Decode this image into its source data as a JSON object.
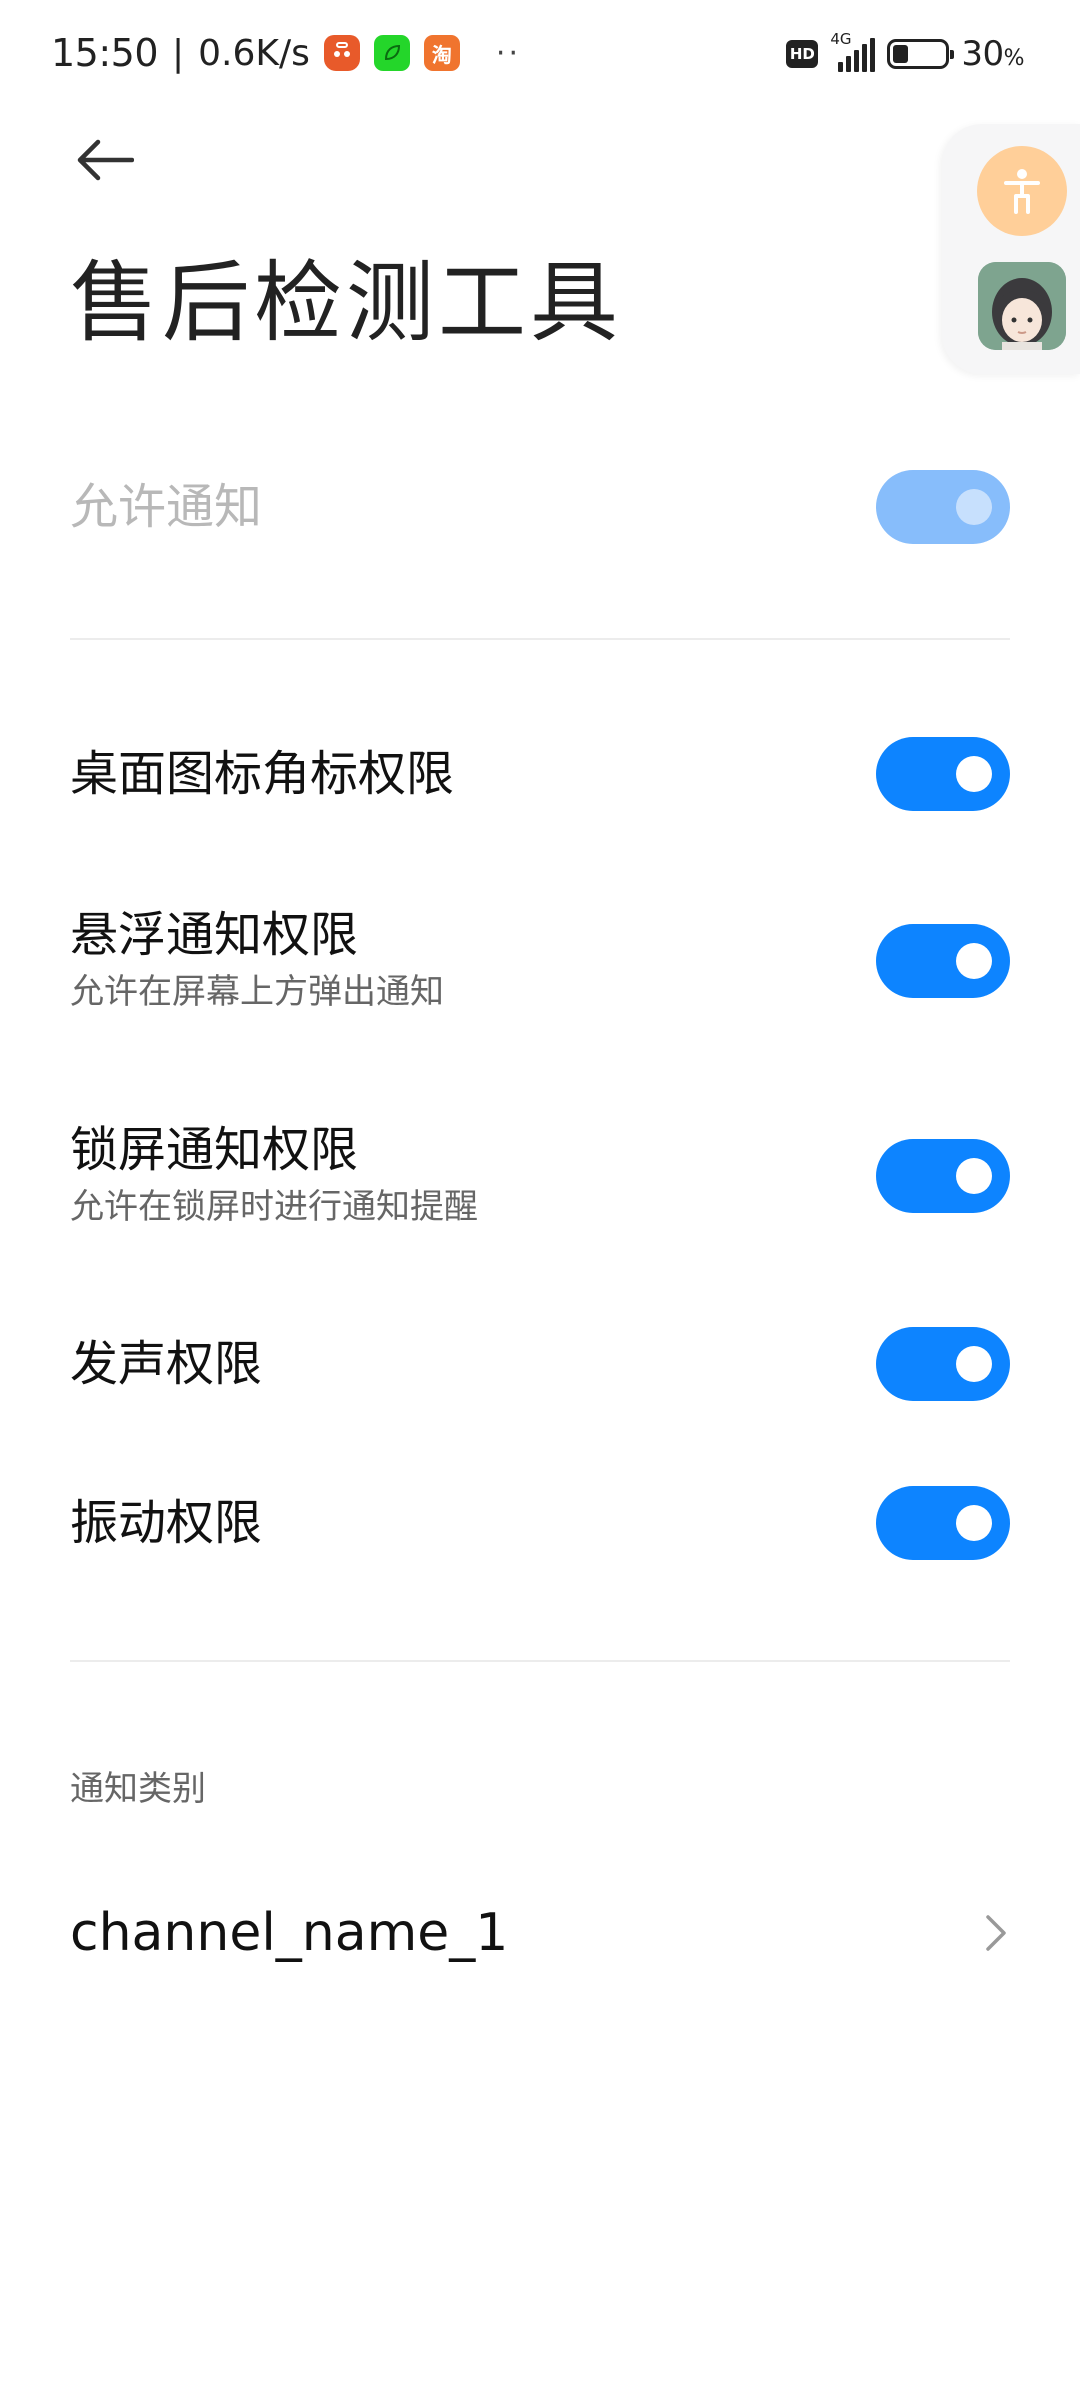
{
  "status_bar": {
    "time": "15:50",
    "separator": "|",
    "net_speed": "0.6K/s",
    "app_icons": [
      "shopping-bag-icon",
      "green-app-icon",
      "taobao-icon"
    ],
    "taobao_glyph": "淘",
    "more_dots": "··",
    "hd_label": "HD",
    "network_type": "4G",
    "battery_level": 0.3,
    "battery_text": "30",
    "battery_unit": "%"
  },
  "header": {
    "title": "售后检测工具"
  },
  "settings": {
    "allow_notifications": {
      "label": "允许通知",
      "enabled": true,
      "disabled": true
    },
    "items": [
      {
        "label": "桌面图标角标权限",
        "subtitle": "",
        "enabled": true
      },
      {
        "label": "悬浮通知权限",
        "subtitle": "允许在屏幕上方弹出通知",
        "enabled": true
      },
      {
        "label": "锁屏通知权限",
        "subtitle": "允许在锁屏时进行通知提醒",
        "enabled": true
      },
      {
        "label": "发声权限",
        "subtitle": "",
        "enabled": true
      },
      {
        "label": "振动权限",
        "subtitle": "",
        "enabled": true
      }
    ]
  },
  "categories": {
    "header": "通知类别",
    "channels": [
      {
        "label": "channel_name_1"
      }
    ]
  },
  "colors": {
    "toggle_on": "#0d84ff",
    "toggle_disabled": "#87bdfb",
    "accessibility_bg": "#ffcf99"
  }
}
